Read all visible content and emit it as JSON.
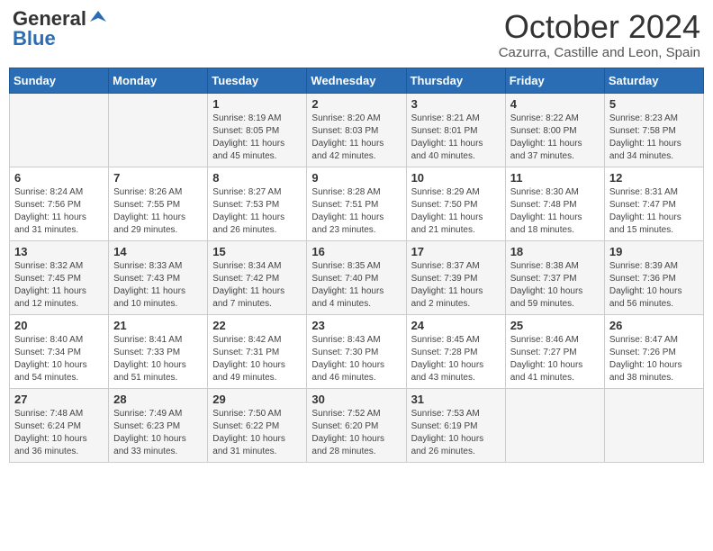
{
  "header": {
    "logo_general": "General",
    "logo_blue": "Blue",
    "month_title": "October 2024",
    "subtitle": "Cazurra, Castille and Leon, Spain"
  },
  "days_of_week": [
    "Sunday",
    "Monday",
    "Tuesday",
    "Wednesday",
    "Thursday",
    "Friday",
    "Saturday"
  ],
  "weeks": [
    [
      {
        "day": "",
        "info": ""
      },
      {
        "day": "",
        "info": ""
      },
      {
        "day": "1",
        "info": "Sunrise: 8:19 AM\nSunset: 8:05 PM\nDaylight: 11 hours and 45 minutes."
      },
      {
        "day": "2",
        "info": "Sunrise: 8:20 AM\nSunset: 8:03 PM\nDaylight: 11 hours and 42 minutes."
      },
      {
        "day": "3",
        "info": "Sunrise: 8:21 AM\nSunset: 8:01 PM\nDaylight: 11 hours and 40 minutes."
      },
      {
        "day": "4",
        "info": "Sunrise: 8:22 AM\nSunset: 8:00 PM\nDaylight: 11 hours and 37 minutes."
      },
      {
        "day": "5",
        "info": "Sunrise: 8:23 AM\nSunset: 7:58 PM\nDaylight: 11 hours and 34 minutes."
      }
    ],
    [
      {
        "day": "6",
        "info": "Sunrise: 8:24 AM\nSunset: 7:56 PM\nDaylight: 11 hours and 31 minutes."
      },
      {
        "day": "7",
        "info": "Sunrise: 8:26 AM\nSunset: 7:55 PM\nDaylight: 11 hours and 29 minutes."
      },
      {
        "day": "8",
        "info": "Sunrise: 8:27 AM\nSunset: 7:53 PM\nDaylight: 11 hours and 26 minutes."
      },
      {
        "day": "9",
        "info": "Sunrise: 8:28 AM\nSunset: 7:51 PM\nDaylight: 11 hours and 23 minutes."
      },
      {
        "day": "10",
        "info": "Sunrise: 8:29 AM\nSunset: 7:50 PM\nDaylight: 11 hours and 21 minutes."
      },
      {
        "day": "11",
        "info": "Sunrise: 8:30 AM\nSunset: 7:48 PM\nDaylight: 11 hours and 18 minutes."
      },
      {
        "day": "12",
        "info": "Sunrise: 8:31 AM\nSunset: 7:47 PM\nDaylight: 11 hours and 15 minutes."
      }
    ],
    [
      {
        "day": "13",
        "info": "Sunrise: 8:32 AM\nSunset: 7:45 PM\nDaylight: 11 hours and 12 minutes."
      },
      {
        "day": "14",
        "info": "Sunrise: 8:33 AM\nSunset: 7:43 PM\nDaylight: 11 hours and 10 minutes."
      },
      {
        "day": "15",
        "info": "Sunrise: 8:34 AM\nSunset: 7:42 PM\nDaylight: 11 hours and 7 minutes."
      },
      {
        "day": "16",
        "info": "Sunrise: 8:35 AM\nSunset: 7:40 PM\nDaylight: 11 hours and 4 minutes."
      },
      {
        "day": "17",
        "info": "Sunrise: 8:37 AM\nSunset: 7:39 PM\nDaylight: 11 hours and 2 minutes."
      },
      {
        "day": "18",
        "info": "Sunrise: 8:38 AM\nSunset: 7:37 PM\nDaylight: 10 hours and 59 minutes."
      },
      {
        "day": "19",
        "info": "Sunrise: 8:39 AM\nSunset: 7:36 PM\nDaylight: 10 hours and 56 minutes."
      }
    ],
    [
      {
        "day": "20",
        "info": "Sunrise: 8:40 AM\nSunset: 7:34 PM\nDaylight: 10 hours and 54 minutes."
      },
      {
        "day": "21",
        "info": "Sunrise: 8:41 AM\nSunset: 7:33 PM\nDaylight: 10 hours and 51 minutes."
      },
      {
        "day": "22",
        "info": "Sunrise: 8:42 AM\nSunset: 7:31 PM\nDaylight: 10 hours and 49 minutes."
      },
      {
        "day": "23",
        "info": "Sunrise: 8:43 AM\nSunset: 7:30 PM\nDaylight: 10 hours and 46 minutes."
      },
      {
        "day": "24",
        "info": "Sunrise: 8:45 AM\nSunset: 7:28 PM\nDaylight: 10 hours and 43 minutes."
      },
      {
        "day": "25",
        "info": "Sunrise: 8:46 AM\nSunset: 7:27 PM\nDaylight: 10 hours and 41 minutes."
      },
      {
        "day": "26",
        "info": "Sunrise: 8:47 AM\nSunset: 7:26 PM\nDaylight: 10 hours and 38 minutes."
      }
    ],
    [
      {
        "day": "27",
        "info": "Sunrise: 7:48 AM\nSunset: 6:24 PM\nDaylight: 10 hours and 36 minutes."
      },
      {
        "day": "28",
        "info": "Sunrise: 7:49 AM\nSunset: 6:23 PM\nDaylight: 10 hours and 33 minutes."
      },
      {
        "day": "29",
        "info": "Sunrise: 7:50 AM\nSunset: 6:22 PM\nDaylight: 10 hours and 31 minutes."
      },
      {
        "day": "30",
        "info": "Sunrise: 7:52 AM\nSunset: 6:20 PM\nDaylight: 10 hours and 28 minutes."
      },
      {
        "day": "31",
        "info": "Sunrise: 7:53 AM\nSunset: 6:19 PM\nDaylight: 10 hours and 26 minutes."
      },
      {
        "day": "",
        "info": ""
      },
      {
        "day": "",
        "info": ""
      }
    ]
  ]
}
